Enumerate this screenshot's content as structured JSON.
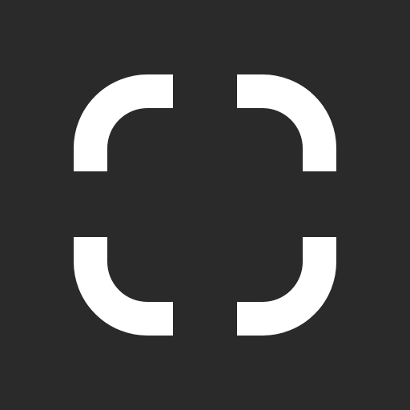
{
  "icon": {
    "name": "scan-frame-icon",
    "background_color": "#2a2a2a",
    "foreground_color": "#ffffff"
  }
}
